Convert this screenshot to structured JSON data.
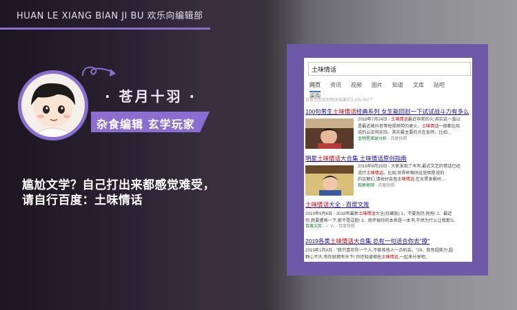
{
  "header": {
    "brand": "HUAN LE XIANG BIAN JI BU 欢乐向编辑部"
  },
  "profile": {
    "name": "· 苍月十羽 ·",
    "tag": "杂食编辑 玄学玩家"
  },
  "description": {
    "line1": "尴尬文学？自己打出来都感觉难受，",
    "line2": "请自行百度：土味情话"
  },
  "search": {
    "query": "土味情话",
    "tabs": [
      "网页",
      "资讯",
      "视频",
      "图片",
      "知道",
      "文库",
      "贴吧",
      "采购"
    ],
    "active_tab": "网页",
    "result_count": "百度为您找到相关结果约3,200,000个",
    "results": [
      {
        "title_pre": "100句男生",
        "title_hl": "土味情话",
        "title_post": "经典系列 女生能回怼一下试试战斗力有多么",
        "lines": [
          "2018年7月24日 - ",
          "土味情话",
          "最近非常的火,其实这一直以",
          "是最近被抖音等短视频带的更火。",
          "土味情话",
          "一般都比较",
          "说的公正和实际。其实最主要的点在反转。比如..."
        ],
        "source": "金明星滚球分析",
        "source_meta": " - 百度快照"
      },
      {
        "title_pre": "明星",
        "title_hl": "土味情话",
        "title_post": "大合集 土味情话原创指南",
        "lines": [
          "2018年6月19日 - 大家发现了木有,最近文艺的情话已经",
          "流行",
          "土味情话",
          "。比如,世界杯期间这些明星说的",
          "的见解们,请收好这些",
          "土味情话",
          ",在女票发飙时..."
        ],
        "source": "观察者网",
        "source_meta": " - 百度快照"
      },
      {
        "title_pre": "",
        "title_hl": "土味情话",
        "title_post": "大全 - 百度文库",
        "lines": [
          "2019年9月6日 - 2018年最新",
          "土味情话",
          "大全(珍藏版) 1、不要抱怨,拖拖! 2、最近",
          "你,我要遭难一下,那不是逗胆! 3、我怀揣你的本质是一本书,不然为什么让我那么"
        ],
        "source": "百度文库",
        "source_meta": " - ✓ V₃ - 百度快照"
      },
      {
        "title_pre": "2019各类",
        "title_hl": "土味情话",
        "title_post": "大合集 总有一句适合你去\"撩\"",
        "lines": [
          "2019年1月4日 - \"我只喜欢你一个人,不做其他人一点机会。\"29、我有超能力,超",
          "野心不大,有你就拥有天下! 你还知道哪些",
          "土味情话",
          ",一起来分享吧。"
        ],
        "source": "",
        "source_meta": ""
      }
    ]
  }
}
